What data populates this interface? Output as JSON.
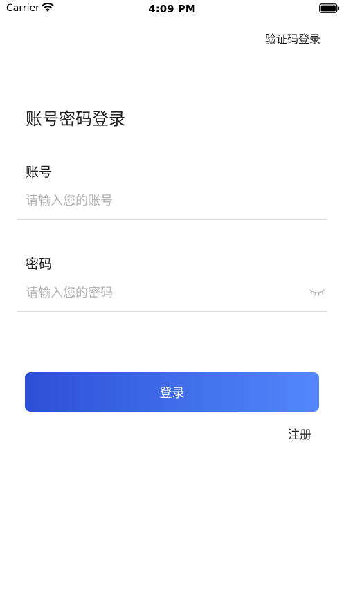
{
  "status_bar": {
    "carrier": "Carrier",
    "time": "4:09 PM"
  },
  "header": {
    "switch_login_label": "验证码登录"
  },
  "form": {
    "title": "账号密码登录",
    "account": {
      "label": "账号",
      "placeholder": "请输入您的账号",
      "value": ""
    },
    "password": {
      "label": "密码",
      "placeholder": "请输入您的密码",
      "value": "",
      "toggle_icon": "eye-closed-icon"
    },
    "login_button_label": "登录",
    "register_label": "注册"
  },
  "colors": {
    "button_gradient_start": "#2c4fd8",
    "button_gradient_end": "#5487fb",
    "placeholder": "#b5b5b5",
    "divider": "#e2e2e2"
  }
}
